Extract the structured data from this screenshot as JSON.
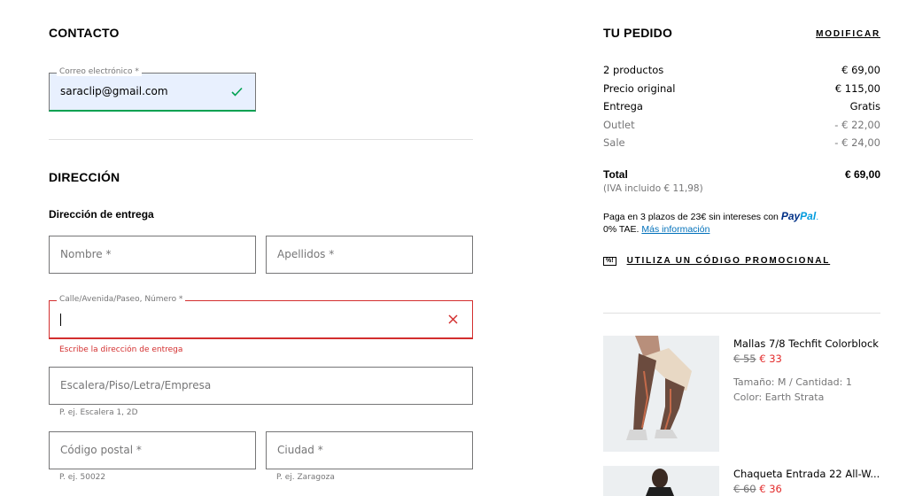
{
  "contact": {
    "title": "CONTACTO",
    "email_label": "Correo electrónico *",
    "email_value": "saraclip@gmail.com"
  },
  "address": {
    "title": "DIRECCIÓN",
    "subtitle": "Dirección de entrega",
    "first_name_placeholder": "Nombre *",
    "last_name_placeholder": "Apellidos *",
    "street_label": "Calle/Avenida/Paseo, Número *",
    "street_error": "Escribe la dirección de entrega",
    "extra_placeholder": "Escalera/Piso/Letra/Empresa",
    "extra_helper": "P. ej. Escalera 1, 2D",
    "postal_placeholder": "Código postal *",
    "postal_helper": "P. ej. 50022",
    "city_placeholder": "Ciudad *",
    "city_helper": "P. ej. Zaragoza"
  },
  "order": {
    "title": "TU PEDIDO",
    "modify_label": "MODIFICAR",
    "lines": [
      {
        "label": "2 productos",
        "value": "€ 69,00",
        "muted": false
      },
      {
        "label": "Precio original",
        "value": "€ 115,00",
        "muted": false
      },
      {
        "label": "Entrega",
        "value": "Gratis",
        "muted": false
      },
      {
        "label": "Outlet",
        "value": "- € 22,00",
        "muted": true
      },
      {
        "label": "Sale",
        "value": "- € 24,00",
        "muted": true
      }
    ],
    "total_label": "Total",
    "total_value": "€ 69,00",
    "vat_note": "(IVA incluido  € 11,98)",
    "paypal_text": "Paga en 3 plazos de 23€ sin intereses con",
    "paypal_logo_a": "Pay",
    "paypal_logo_b": "Pal",
    "paypal_suffix": ".",
    "paypal_tae": "0% TAE.",
    "paypal_more": "Más información",
    "promo_icon": "%!",
    "promo_label": "UTILIZA UN CÓDIGO PROMOCIONAL"
  },
  "products": [
    {
      "name": "Mallas 7/8 Techfit Colorblock",
      "old_price": "€ 55",
      "new_price": "€ 33",
      "detail1": "Tamaño: M / Cantidad: 1",
      "detail2": "Color: Earth Strata"
    },
    {
      "name": "Chaqueta Entrada 22 All-W...",
      "old_price": "€ 60",
      "new_price": "€ 36"
    }
  ],
  "colors": {
    "success": "#00a151",
    "error": "#d32f2f",
    "sale_red": "#e32b2b",
    "autofill_bg": "#e8f0fe"
  },
  "icons": {
    "email_valid": "check-icon",
    "street_error": "close-icon",
    "promo": "promo-tag-icon"
  }
}
